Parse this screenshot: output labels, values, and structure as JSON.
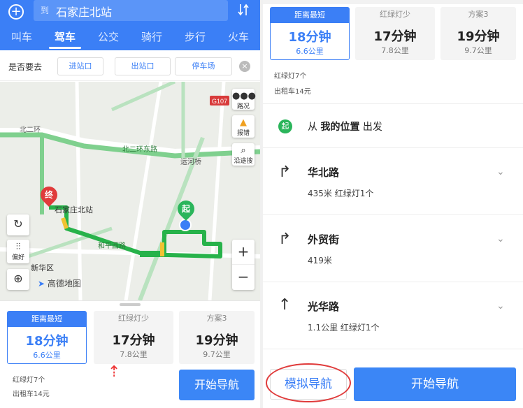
{
  "left": {
    "search": {
      "prefix": "到",
      "destination": "石家庄北站"
    },
    "modes": [
      "叫车",
      "驾车",
      "公交",
      "骑行",
      "步行",
      "火车"
    ],
    "active_mode_index": 1,
    "goto": {
      "label": "是否要去",
      "chips": [
        "进站口",
        "出站口",
        "停车场"
      ]
    },
    "map": {
      "road_badge": "G107",
      "tools": [
        {
          "icon": "traffic-icon",
          "label": "路况"
        },
        {
          "icon": "warning-icon",
          "label": "报错"
        },
        {
          "icon": "search-icon",
          "label": "沿途搜"
        }
      ],
      "pref_label": "偏好",
      "labels": {
        "station": "石家庄北站",
        "district": "新华区",
        "logo": "高德地图",
        "end_marker": "终",
        "start_marker": "起",
        "road_north2": "北二环",
        "road_north2_east": "北二环东路",
        "road_heping": "和平西路",
        "road_yunhe": "运河桥"
      },
      "zoom_in": "+",
      "zoom_out": "−"
    },
    "plans": [
      {
        "tag": "距离最短",
        "time": "18分钟",
        "distance": "6.6公里"
      },
      {
        "tag": "红绿灯少",
        "time": "17分钟",
        "distance": "7.8公里"
      },
      {
        "tag": "方案3",
        "time": "19分钟",
        "distance": "9.7公里"
      }
    ],
    "traffic_lights": "红绿灯7个",
    "taxi_fare": "出租车14元",
    "start_nav": "开始导航"
  },
  "right": {
    "plans": [
      {
        "tag": "距离最短",
        "time": "18分钟",
        "distance": "6.6公里"
      },
      {
        "tag": "红绿灯少",
        "time": "17分钟",
        "distance": "7.8公里"
      },
      {
        "tag": "方案3",
        "time": "19分钟",
        "distance": "9.7公里"
      }
    ],
    "traffic_lights": "红绿灯7个",
    "taxi_fare": "出租车14元",
    "start_badge": "起",
    "start_text_pre": "从",
    "start_text_bold": "我的位置",
    "start_text_post": "出发",
    "steps": [
      {
        "icon": "turn-right-icon",
        "title": "华北路",
        "sub": "435米 红绿灯1个"
      },
      {
        "icon": "turn-right-icon",
        "title": "外贸街",
        "sub": "419米"
      },
      {
        "icon": "straight-arrow-icon",
        "title": "光华路",
        "sub": "1.1公里 红绿灯1个"
      }
    ],
    "simulate_nav": "模拟导航",
    "start_nav": "开始导航"
  },
  "colors": {
    "brand_blue": "#3b7ff6",
    "route_green": "#27b24a",
    "highlight_red": "#e03b3b"
  }
}
